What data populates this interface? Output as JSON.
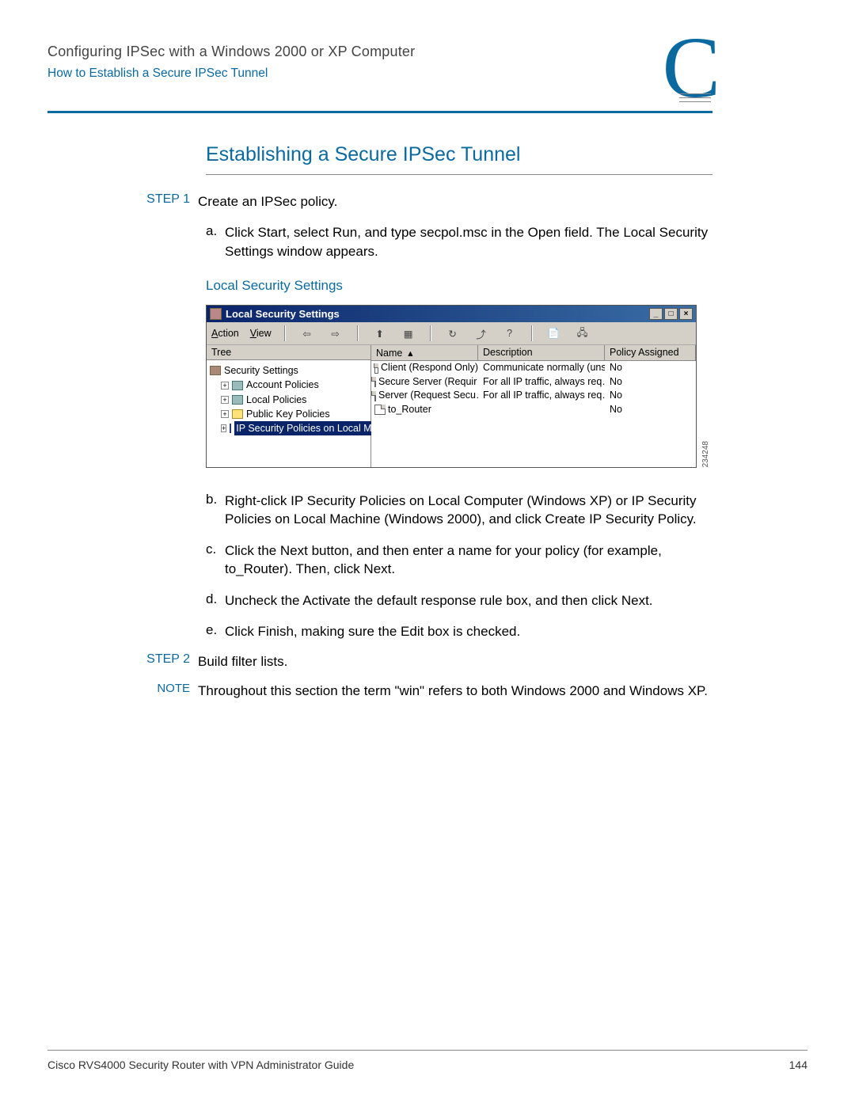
{
  "header": {
    "title": "Configuring IPSec with a Windows 2000 or XP Computer",
    "subtitle": "How to Establish a Secure IPSec Tunnel",
    "appendix_letter": "C"
  },
  "section_title": "Establishing a Secure IPSec Tunnel",
  "steps": {
    "s1_label": "STEP 1",
    "s1_text": "Create an IPSec policy.",
    "s1a_label": "a.",
    "s1a_text": "Click Start, select Run, and type secpol.msc in the Open field. The Local Security Settings window appears.",
    "caption": "Local Security Settings",
    "s1b_label": "b.",
    "s1b_text": "Right-click IP Security Policies on Local Computer (Windows XP) or IP Security Policies on Local Machine (Windows 2000), and click Create IP Security Policy.",
    "s1c_label": "c.",
    "s1c_text": "Click the Next button, and then enter a name for your policy (for example, to_Router). Then, click Next.",
    "s1d_label": "d.",
    "s1d_text": "Uncheck the Activate the default response rule box, and then click Next.",
    "s1e_label": "e.",
    "s1e_text": "Click Finish, making sure the Edit box is checked.",
    "s2_label": "STEP 2",
    "s2_text": "Build filter lists.",
    "note_label": "NOTE",
    "note_text": "Throughout this section the term \"win\" refers to both Windows 2000 and Windows XP."
  },
  "window": {
    "title": "Local Security Settings",
    "menu_action": "Action",
    "menu_view": "View",
    "tree_header": "Tree",
    "tree": {
      "root": "Security Settings",
      "account": "Account Policies",
      "local": "Local Policies",
      "pk": "Public Key Policies",
      "ipsec": "IP Security Policies on Local Machine"
    },
    "cols": {
      "name": "Name",
      "desc": "Description",
      "policy": "Policy Assigned"
    },
    "rows": [
      {
        "name": "Client (Respond Only)",
        "desc": "Communicate normally (uns…",
        "policy": "No"
      },
      {
        "name": "Secure Server (Requir…",
        "desc": "For all IP traffic, always req…",
        "policy": "No"
      },
      {
        "name": "Server (Request Secu…",
        "desc": "For all IP traffic, always req…",
        "policy": "No"
      },
      {
        "name": "to_Router",
        "desc": "",
        "policy": "No"
      }
    ],
    "image_id": "234248",
    "wc": {
      "min": "_",
      "max": "□",
      "close": "×"
    }
  },
  "footer": {
    "doc": "Cisco RVS4000 Security Router with VPN Administrator Guide",
    "page": "144"
  }
}
